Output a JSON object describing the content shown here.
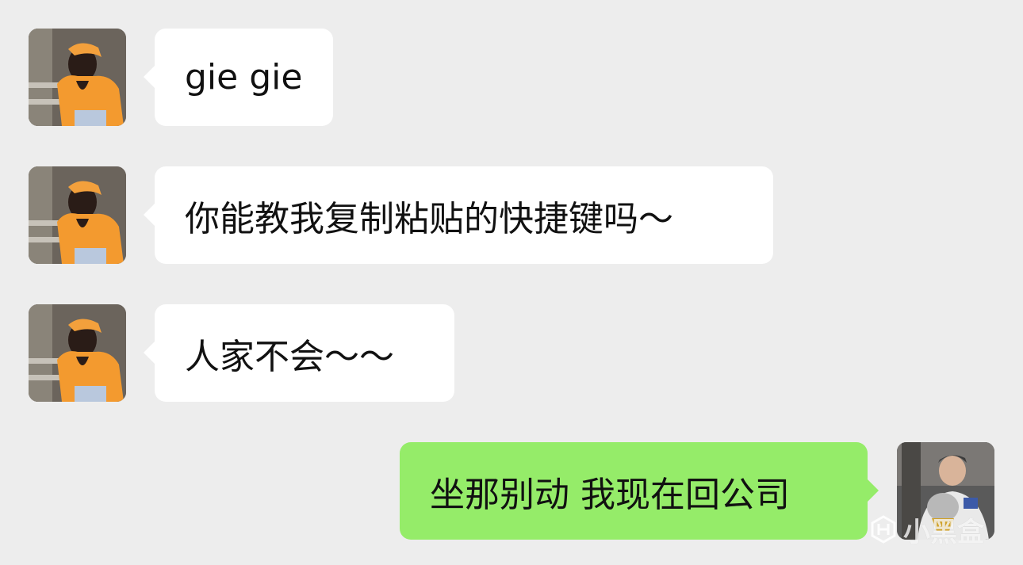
{
  "messages": [
    {
      "side": "left",
      "text": "gie gie"
    },
    {
      "side": "left",
      "text": "你能教我复制粘贴的快捷键吗～"
    },
    {
      "side": "left",
      "text": "人家不会～～"
    },
    {
      "side": "right",
      "text": "坐那别动 我现在回公司"
    }
  ],
  "watermark": {
    "text": "小黑盒",
    "icon": "heybox-logo-icon"
  },
  "colors": {
    "background": "#ededed",
    "incoming_bubble": "#ffffff",
    "outgoing_bubble": "#95ec69",
    "text": "#111111"
  }
}
